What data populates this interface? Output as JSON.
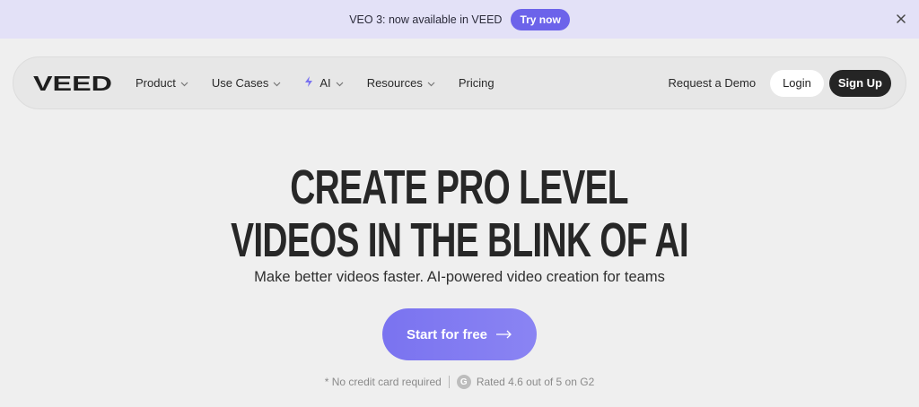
{
  "announcement": {
    "text": "VEO 3: now available in VEED",
    "button_label": "Try now",
    "close_icon": "close-icon"
  },
  "nav": {
    "logo_text": "VEED",
    "items": [
      {
        "label": "Product",
        "has_dropdown": true
      },
      {
        "label": "Use Cases",
        "has_dropdown": true
      },
      {
        "label": "AI",
        "has_dropdown": true,
        "icon": "sparkle-icon"
      },
      {
        "label": "Resources",
        "has_dropdown": true
      },
      {
        "label": "Pricing",
        "has_dropdown": false
      }
    ],
    "request_demo": "Request a Demo",
    "login": "Login",
    "signup": "Sign Up"
  },
  "hero": {
    "headline_line1": "CREATE PRO LEVEL",
    "headline_line2": "VIDEOS IN THE BLINK OF AI",
    "subhead": "Make better videos faster. AI-powered video creation for teams",
    "cta_label": "Start for free",
    "cta_icon": "arrow-right-icon",
    "note_left": "* No credit card required",
    "note_right": "Rated 4.6 out of 5 on G2",
    "g2_badge": "G"
  },
  "colors": {
    "accent": "#6c63ea",
    "cta": "#7a73f0",
    "announce_bg": "#e3e1f7",
    "page_bg": "#efefef"
  }
}
